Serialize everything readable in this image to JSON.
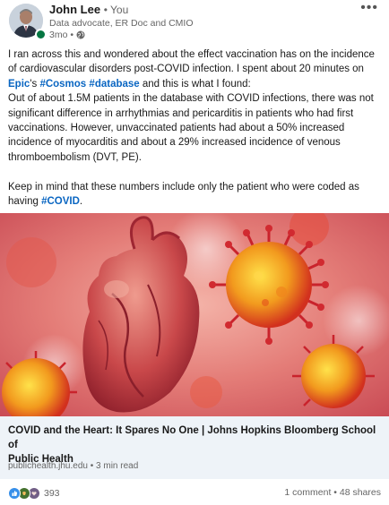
{
  "author": {
    "name": "John Lee",
    "relation": "• You",
    "title": "Data advocate, ER Doc and CMIO",
    "time": "3mo •"
  },
  "post": {
    "l1": "I ran across this and wondered about the effect vaccination has on the incidence",
    "l2": "of cardiovascular disorders post-COVID infection. I spent about 20 minutes on",
    "l3_tag1": "Epic",
    "l3_mid": "'s ",
    "l3_tag2": "#Cosmos",
    "l3_tag3": "#database",
    "l3_end": " and this is what I found:",
    "l4": "Out of about 1.5M patients in the database with COVID infections, there was not",
    "l5": "significant difference in arrhythmias and pericarditis in patients who had first",
    "l6": "vaccinations. However, unvaccinated patients had about a 50% increased",
    "l7": "incidence of myocarditis and about a 29% increased incidence of venous",
    "l8": "thromboembolism (DVT, PE).",
    "l9": "Keep in mind that these numbers include only the patient who were coded as",
    "l10_pre": "having ",
    "l10_tag": "#COVID",
    "l10_end": "."
  },
  "link_card": {
    "title_l1": "COVID and the Heart: It Spares No One | Johns Hopkins Bloomberg School of",
    "title_l2": "Public Health",
    "meta": "publichealth.jhu.edu • 3 min read"
  },
  "social": {
    "reaction_count": "393",
    "comments": "1 comment",
    "separator": " • ",
    "shares": "48 shares"
  },
  "icons": {
    "more": "more-options-icon",
    "globe": "globe-icon",
    "reactions": [
      "like-reaction-icon",
      "celebrate-reaction-icon",
      "support-reaction-icon"
    ]
  },
  "colors": {
    "hashtag": "#0a66c2",
    "card_bg": "#eef3f8",
    "presence": "#057642",
    "secondary_text": "#666666"
  }
}
